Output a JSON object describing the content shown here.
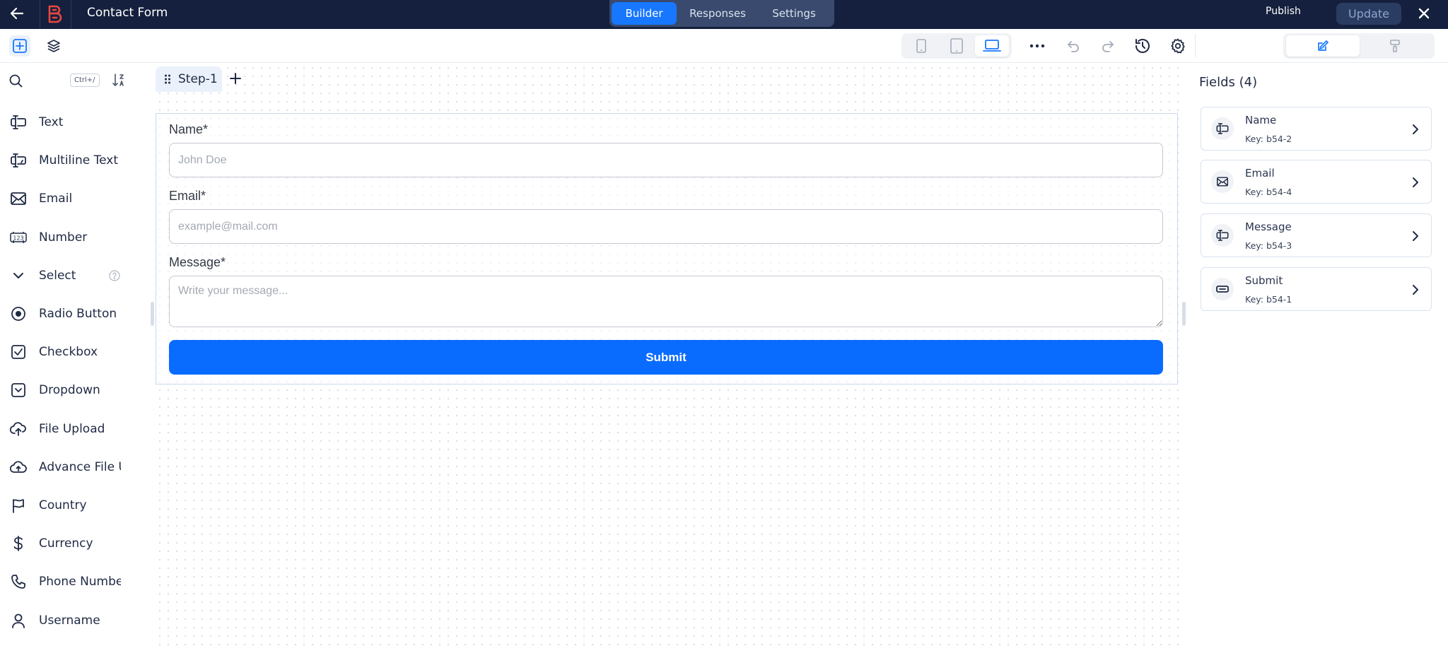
{
  "topbar": {
    "title": "Contact Form",
    "tabs": [
      {
        "label": "Builder",
        "active": true
      },
      {
        "label": "Responses",
        "active": false
      },
      {
        "label": "Settings",
        "active": false
      }
    ],
    "publish_label": "Publish",
    "update_label": "Update"
  },
  "sidebar": {
    "search": {
      "placeholder": "",
      "shortcut": "Ctrl+/"
    },
    "items": [
      {
        "label": "Text",
        "icon": "text-field-icon"
      },
      {
        "label": "Multiline Text",
        "icon": "multiline-text-icon"
      },
      {
        "label": "Email",
        "icon": "email-icon"
      },
      {
        "label": "Number",
        "icon": "number-icon"
      },
      {
        "label": "Select",
        "icon": "chevron-down-icon"
      },
      {
        "label": "Radio Button",
        "icon": "radio-icon"
      },
      {
        "label": "Checkbox",
        "icon": "checkbox-icon"
      },
      {
        "label": "Dropdown",
        "icon": "dropdown-icon"
      },
      {
        "label": "File Upload",
        "icon": "upload-icon"
      },
      {
        "label": "Advance File Upload",
        "icon": "cloud-upload-icon"
      },
      {
        "label": "Country",
        "icon": "flag-icon"
      },
      {
        "label": "Currency",
        "icon": "dollar-icon"
      },
      {
        "label": "Phone Number",
        "icon": "phone-icon"
      },
      {
        "label": "Username",
        "icon": "user-icon"
      }
    ]
  },
  "canvas": {
    "step_label": "Step-1",
    "form": {
      "name_label": "Name*",
      "name_placeholder": "John Doe",
      "email_label": "Email*",
      "email_placeholder": "example@mail.com",
      "message_label": "Message*",
      "message_placeholder": "Write your message...",
      "submit_label": "Submit"
    }
  },
  "right_panel": {
    "title": "Fields (4)",
    "fields": [
      {
        "name": "Name",
        "key": "Key: b54-2",
        "icon": "text-field-icon"
      },
      {
        "name": "Email",
        "key": "Key: b54-4",
        "icon": "email-icon"
      },
      {
        "name": "Message",
        "key": "Key: b54-3",
        "icon": "text-field-icon"
      },
      {
        "name": "Submit",
        "key": "Key: b54-1",
        "icon": "button-icon"
      }
    ]
  },
  "colors": {
    "topbar_bg": "#14203d",
    "accent": "#0a6bff",
    "brand_logo": "#e8473f"
  }
}
